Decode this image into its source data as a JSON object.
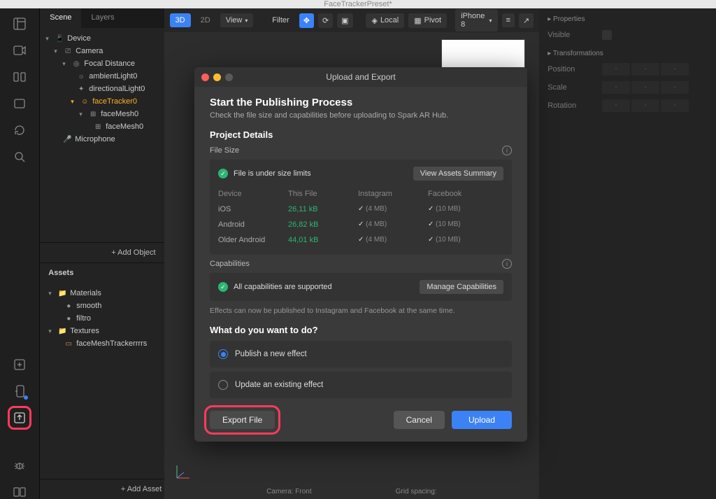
{
  "window_title": "FaceTrackerPreset*",
  "scene_tabs": {
    "scene": "Scene",
    "layers": "Layers"
  },
  "tree": {
    "device": "Device",
    "camera": "Camera",
    "focal": "Focal Distance",
    "ambient": "ambientLight0",
    "directional": "directionalLight0",
    "facetracker": "faceTracker0",
    "facemesh0a": "faceMesh0",
    "facemesh0b": "faceMesh0",
    "microphone": "Microphone"
  },
  "add_object": "+  Add Object",
  "assets": {
    "heading": "Assets",
    "materials": "Materials",
    "smooth": "smooth",
    "filtro": "filtro",
    "textures": "Textures",
    "facemeshtex": "faceMeshTrackerrrrs",
    "add_asset": "+  Add Asset"
  },
  "toolbar": {
    "b3d": "3D",
    "b2d": "2D",
    "view": "View",
    "filter": "Filter",
    "local": "Local",
    "pivot": "Pivot",
    "device": "iPhone 8"
  },
  "properties": {
    "heading": "Properties",
    "visible": "Visible",
    "transformations": "Transformations",
    "position": "Position",
    "scale": "Scale",
    "rotation": "Rotation",
    "dash": "-"
  },
  "status": {
    "camera": "Camera: Front",
    "grid": "Grid spacing:"
  },
  "modal": {
    "title": "Upload and Export",
    "h2": "Start the Publishing Process",
    "sub": "Check the file size and capabilities before uploading to Spark AR Hub.",
    "details": "Project Details",
    "filesize": "File Size",
    "under_limits": "File is under size limits",
    "view_summary": "View Assets Summary",
    "cols": {
      "device": "Device",
      "thisfile": "This File",
      "instagram": "Instagram",
      "facebook": "Facebook"
    },
    "rows": [
      {
        "device": "iOS",
        "size": "26,11 kB",
        "ig": "(4 MB)",
        "fb": "(10 MB)"
      },
      {
        "device": "Android",
        "size": "26,82 kB",
        "ig": "(4 MB)",
        "fb": "(10 MB)"
      },
      {
        "device": "Older Android",
        "size": "44,01 kB",
        "ig": "(4 MB)",
        "fb": "(10 MB)"
      }
    ],
    "capabilities": "Capabilities",
    "cap_ok": "All capabilities are supported",
    "manage_cap": "Manage Capabilities",
    "note": "Effects can now be published to Instagram and Facebook at the same time.",
    "want": "What do you want to do?",
    "publish": "Publish a new effect",
    "update": "Update an existing effect",
    "export": "Export File",
    "cancel": "Cancel",
    "upload": "Upload"
  }
}
